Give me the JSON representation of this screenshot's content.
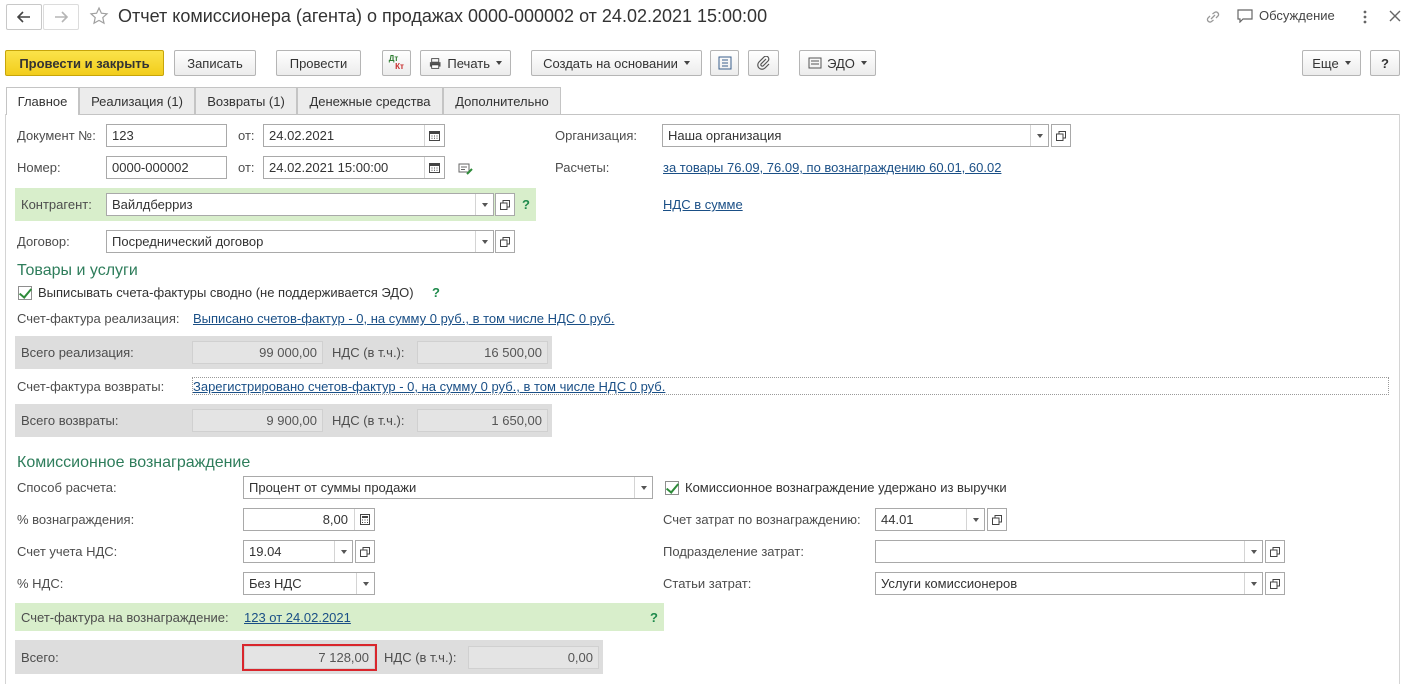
{
  "title": "Отчет комиссионера (агента) о продажах 0000-000002 от 24.02.2021 15:00:00",
  "header": {
    "discussion": "Обсуждение"
  },
  "toolbar": {
    "post_close": "Провести и закрыть",
    "write": "Записать",
    "post": "Провести",
    "dtkt_top": "Дт",
    "dtkt_bottom": "Кт",
    "print": "Печать",
    "create_based": "Создать на основании",
    "edo": "ЭДО",
    "more": "Еще",
    "help": "?"
  },
  "tabs": [
    "Главное",
    "Реализация (1)",
    "Возвраты (1)",
    "Денежные средства",
    "Дополнительно"
  ],
  "form": {
    "doc_label": "Документ №:",
    "doc_value": "123",
    "from_label": "от:",
    "doc_date": "24.02.2021",
    "number_label": "Номер:",
    "number_value": "0000-000002",
    "number_date": "24.02.2021 15:00:00",
    "org_label": "Организация:",
    "org_value": "Наша организация",
    "calc_label": "Расчеты:",
    "calc_link": "за товары 76.09, 76.09, по вознаграждению 60.01, 60.02",
    "vat_sum_link": "НДС в сумме",
    "contractor_label": "Контрагент:",
    "contractor_value": "Вайлдберриз",
    "contract_label": "Договор:",
    "contract_value": "Посреднический договор",
    "q": "?"
  },
  "goods": {
    "title": "Товары и услуги",
    "checkbox_label": "Выписывать счета-фактуры сводно (не поддерживается ЭДО)",
    "q": "?",
    "sales_invoice_label": "Счет-фактура реализация:",
    "sales_invoice_link": "Выписано счетов-фактур - 0, на сумму 0 руб., в том числе НДС 0 руб.",
    "total_sales_label": "Всего реализация:",
    "total_sales": "99 000,00",
    "vat_label": "НДС (в т.ч.):",
    "total_sales_vat": "16 500,00",
    "returns_invoice_label": "Счет-фактура возвраты:",
    "returns_invoice_link": "Зарегистрировано счетов-фактур - 0, на сумму 0 руб., в том числе НДС 0 руб.",
    "total_returns_label": "Всего возвраты:",
    "total_returns": "9 900,00",
    "total_returns_vat": "1 650,00"
  },
  "commission": {
    "title": "Комиссионное вознаграждение",
    "method_label": "Способ расчета:",
    "method_value": "Процент от суммы продажи",
    "withheld_label": "Комиссионное вознаграждение удержано из выручки",
    "percent_label": "% вознаграждения:",
    "percent_value": "8,00",
    "cost_account_label": "Счет затрат по вознаграждению:",
    "cost_account_value": "44.01",
    "vat_account_label": "Счет учета НДС:",
    "vat_account_value": "19.04",
    "cost_division_label": "Подразделение затрат:",
    "cost_division_value": "",
    "vat_rate_label": "% НДС:",
    "vat_rate_value": "Без НДС",
    "cost_items_label": "Статьи затрат:",
    "cost_items_value": "Услуги комиссионеров",
    "invoice_label": "Счет-фактура на вознаграждение:",
    "invoice_link": "123 от 24.02.2021",
    "q": "?",
    "total_label": "Всего:",
    "total_value": "7 128,00",
    "vat_label": "НДС (в т.ч.):",
    "total_vat": "0,00"
  },
  "colors": {
    "highlight_border": "#d9262c",
    "primary_button": "#f5d52a",
    "section_title": "#2e7d5b",
    "link": "#1a4f86"
  }
}
